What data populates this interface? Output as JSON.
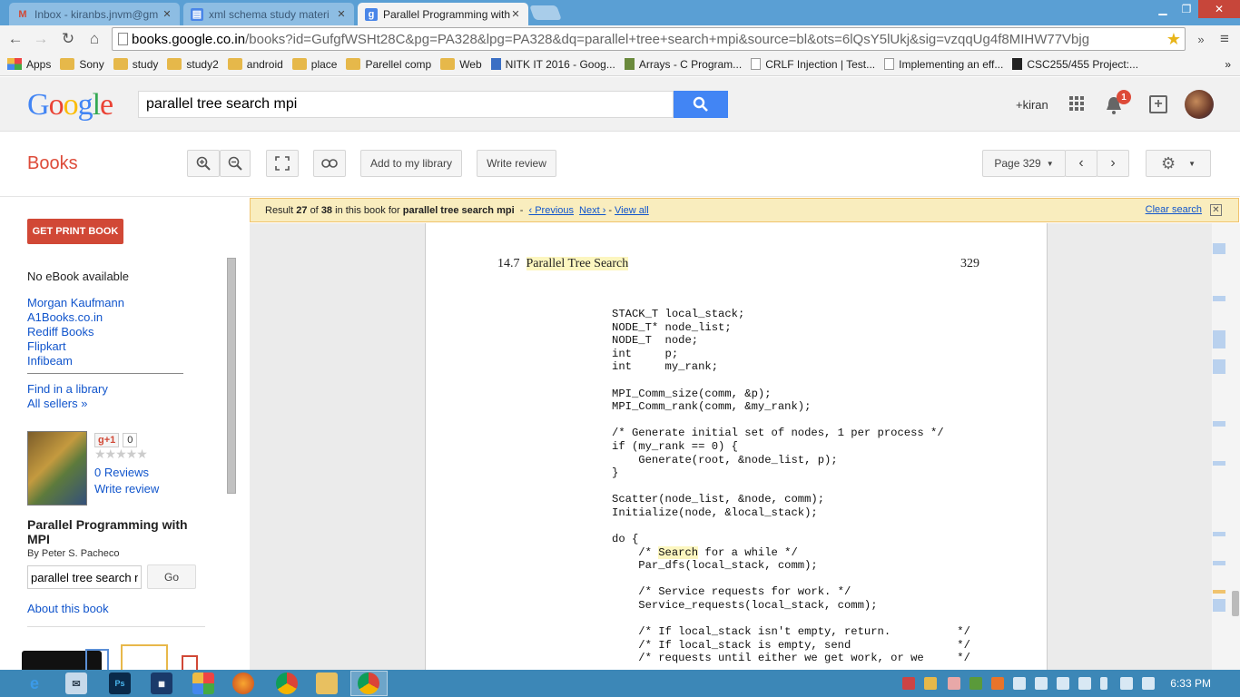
{
  "browser": {
    "tabs": [
      {
        "title": "Inbox - kiranbs.jnvm@gm",
        "favicon": "gmail-icon"
      },
      {
        "title": "xml schema study materi",
        "favicon": "docs-icon"
      },
      {
        "title": "Parallel Programming with",
        "favicon": "google-books-icon",
        "active": true
      }
    ],
    "url_host": "books.google.co.in",
    "url_rest": "/books?id=GufgfWSHt28C&pg=PA328&lpg=PA328&dq=parallel+tree+search+mpi&source=bl&ots=6lQsY5lUkj&sig=vzqqUg4f8MIHW77Vbjg",
    "bookmarks": [
      {
        "label": "Apps",
        "icon": "apps-icon"
      },
      {
        "label": "Sony",
        "icon": "folder-icon"
      },
      {
        "label": "study",
        "icon": "folder-icon"
      },
      {
        "label": "study2",
        "icon": "folder-icon"
      },
      {
        "label": "android",
        "icon": "folder-icon"
      },
      {
        "label": "place",
        "icon": "folder-icon"
      },
      {
        "label": "Parellel comp",
        "icon": "folder-icon"
      },
      {
        "label": "Web",
        "icon": "folder-icon"
      },
      {
        "label": "NITK IT 2016 - Goog...",
        "icon": "page-icon"
      },
      {
        "label": "Arrays - C Program...",
        "icon": "page-icon"
      },
      {
        "label": "CRLF Injection | Test...",
        "icon": "page-icon"
      },
      {
        "label": "Implementing an eff...",
        "icon": "page-icon"
      },
      {
        "label": "CSC255/455 Project:...",
        "icon": "page-icon"
      }
    ],
    "bookmarks_overflow": "»"
  },
  "google_bar": {
    "search_query": "parallel tree search mpi",
    "user": "+kiran",
    "notification_count": "1"
  },
  "books": {
    "section_title": "Books",
    "toolbar": {
      "add_library": "Add to my library",
      "write_review": "Write review",
      "page_select": "Page 329"
    },
    "sidebar": {
      "get_print": "GET PRINT BOOK",
      "no_ebook": "No eBook available",
      "sellers": [
        "Morgan Kaufmann",
        "A1Books.co.in",
        "Rediff Books",
        "Flipkart",
        "Infibeam"
      ],
      "find_library": "Find in a library",
      "all_sellers": "All sellers »",
      "gplus": "g+1",
      "gplus_count": "0",
      "reviews": "0 Reviews",
      "write_review": "Write review",
      "book_title": "Parallel Programming with MPI",
      "author": "By Peter S. Pacheco",
      "search_in_book": "parallel tree search mpi",
      "go": "Go",
      "about": "About this book"
    },
    "result_bar": {
      "prefix": "Result",
      "current": "27",
      "of": "of",
      "total": "38",
      "mid": "in this book for",
      "query": "parallel tree search mpi",
      "dash1": "-",
      "previous": "‹ Previous",
      "next": "Next ›",
      "dash2": "-",
      "view_all": "View all",
      "clear": "Clear search"
    },
    "page": {
      "section_number": "14.7",
      "section_name": "Parallel Tree Search",
      "page_number": "329",
      "code_lines": [
        "STACK_T local_stack;",
        "NODE_T* node_list;",
        "NODE_T  node;",
        "int     p;",
        "int     my_rank;",
        "",
        "MPI_Comm_size(comm, &p);",
        "MPI_Comm_rank(comm, &my_rank);",
        "",
        "/* Generate initial set of nodes, 1 per process */",
        "if (my_rank == 0) {",
        "    Generate(root, &node_list, p);",
        "}",
        "",
        "Scatter(node_list, &node, comm);",
        "Initialize(node, &local_stack);",
        "",
        "do {",
        "    /* ",
        "    Par_dfs(local_stack, comm);",
        "",
        "    /* Service requests for work. */",
        "    Service_requests(local_stack, comm);",
        "",
        "    /* If local_stack isn't empty, return.          */",
        "    /* If local_stack is empty, send                */",
        "    /* requests until either we get work, or we     */"
      ],
      "search_line": {
        "pre": "    /* ",
        "word": "Search",
        "post": " for a while */"
      }
    }
  },
  "taskbar": {
    "clock": "6:33 PM"
  },
  "colors": {
    "books_red": "#dd4b39",
    "google_blue": "#4285f4",
    "result_bg": "#f9edbe",
    "highlight": "#fcf6bf"
  }
}
